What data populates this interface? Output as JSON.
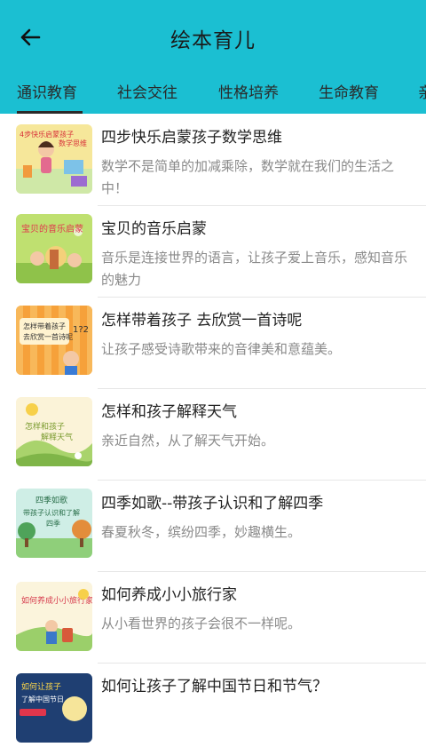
{
  "header": {
    "title": "绘本育儿"
  },
  "tabs": [
    {
      "label": "通识教育",
      "selected": true
    },
    {
      "label": "社会交往",
      "selected": false
    },
    {
      "label": "性格培养",
      "selected": false
    },
    {
      "label": "生命教育",
      "selected": false
    },
    {
      "label": "亲",
      "selected": false
    }
  ],
  "articles": [
    {
      "title": "四步快乐启蒙孩子数学思维",
      "desc": "数学不是简单的加减乘除，数学就在我们的生活之中！",
      "thumb_text": "4步快乐启蒙孩子数学思维"
    },
    {
      "title": "宝贝的音乐启蒙",
      "desc": "音乐是连接世界的语言，让孩子爱上音乐，感知音乐的魅力",
      "thumb_text": "宝贝的音乐启蒙"
    },
    {
      "title": "怎样带着孩子 去欣赏一首诗呢",
      "desc": "让孩子感受诗歌带来的音律美和意蕴美。",
      "thumb_text": "怎样带着孩子去欣赏一首诗呢"
    },
    {
      "title": "怎样和孩子解释天气",
      "desc": "亲近自然，从了解天气开始。",
      "thumb_text": "怎样和孩子解释天气"
    },
    {
      "title": "四季如歌--带孩子认识和了解四季",
      "desc": "春夏秋冬，缤纷四季，妙趣横生。",
      "thumb_text": "四季如歌 带孩子认识和了解四季"
    },
    {
      "title": "如何养成小小旅行家",
      "desc": "从小看世界的孩子会很不一样呢。",
      "thumb_text": "如何养成小小旅行家"
    },
    {
      "title": "如何让孩子了解中国节日和节气？",
      "desc": "",
      "thumb_text": "如何让孩子了解中国节日和节气"
    }
  ]
}
